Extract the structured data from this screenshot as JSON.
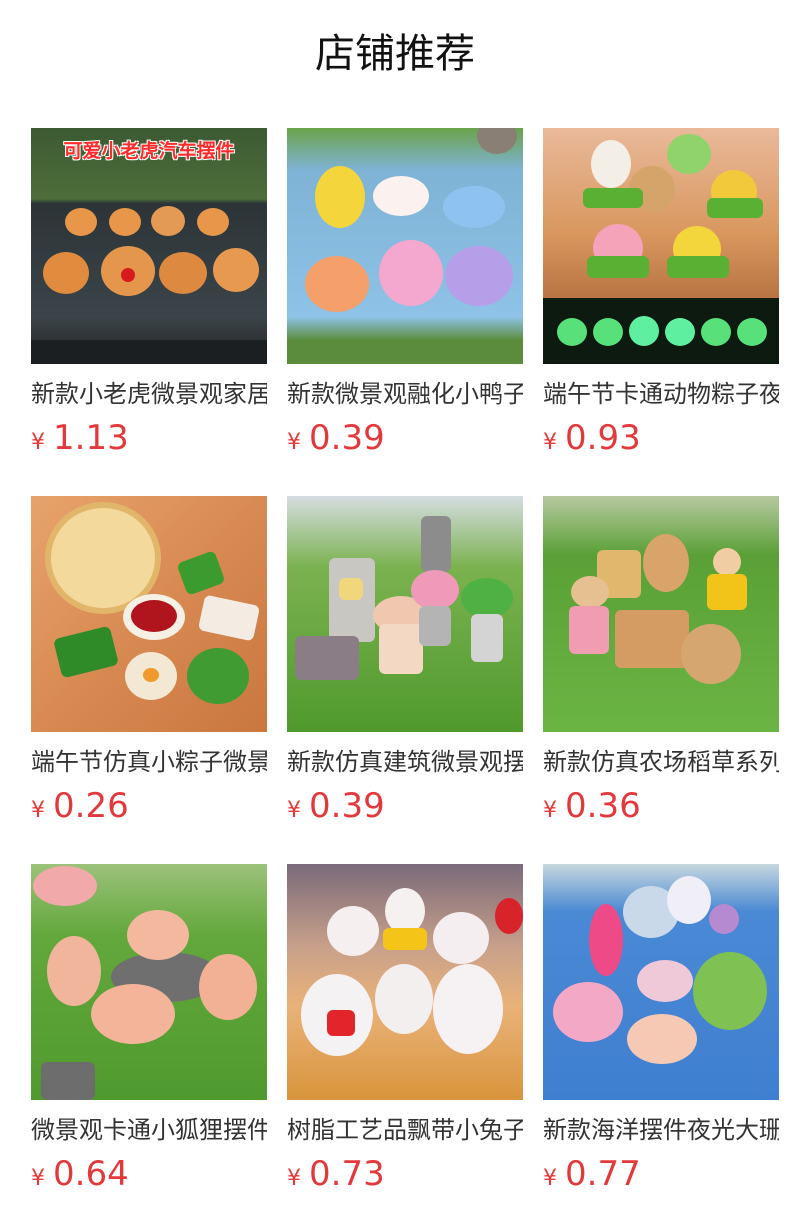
{
  "page": {
    "title": "店铺推荐"
  },
  "products": [
    {
      "name": "新款小老虎微景观家居",
      "currency": "¥",
      "price": "1.13",
      "banner": "可爱小老虎汽车摆件",
      "scene": "tiger"
    },
    {
      "name": "新款微景观融化小鸭子",
      "currency": "¥",
      "price": "0.39",
      "scene": "ducks"
    },
    {
      "name": "端午节卡通动物粽子夜光",
      "currency": "¥",
      "price": "0.93",
      "scene": "zongzi-animals"
    },
    {
      "name": "端午节仿真小粽子微景观",
      "currency": "¥",
      "price": "0.26",
      "scene": "zongzi"
    },
    {
      "name": "新款仿真建筑微景观摆件",
      "currency": "¥",
      "price": "0.39",
      "scene": "lantern"
    },
    {
      "name": "新款仿真农场稻草系列",
      "currency": "¥",
      "price": "0.36",
      "scene": "farm"
    },
    {
      "name": "微景观卡通小狐狸摆件",
      "currency": "¥",
      "price": "0.64",
      "scene": "fox"
    },
    {
      "name": "树脂工艺品飘带小兔子",
      "currency": "¥",
      "price": "0.73",
      "scene": "rabbit"
    },
    {
      "name": "新款海洋摆件夜光大珊瑚",
      "currency": "¥",
      "price": "0.77",
      "scene": "coral"
    }
  ],
  "colors": {
    "price": "#e4393c",
    "title": "#111111",
    "name": "#333333"
  }
}
